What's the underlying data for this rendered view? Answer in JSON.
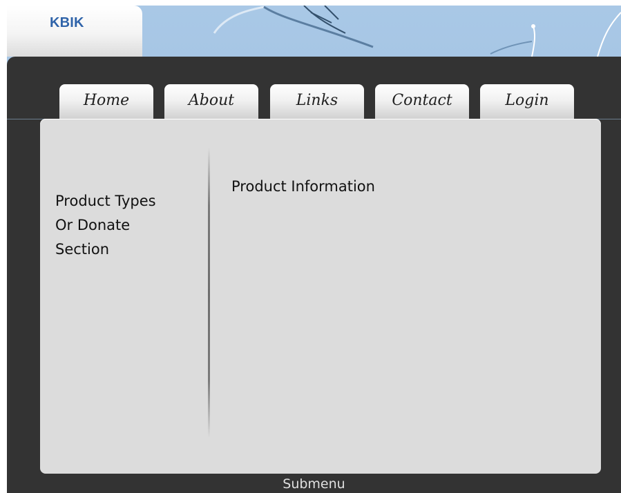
{
  "header": {
    "logo": "KBIK"
  },
  "nav": {
    "tabs": [
      {
        "label": "Home"
      },
      {
        "label": "About"
      },
      {
        "label": "Links"
      },
      {
        "label": "Contact"
      },
      {
        "label": "Login"
      }
    ]
  },
  "sidebar": {
    "text": "Product Types\nOr Donate\nSection"
  },
  "main": {
    "text": "Product Information"
  },
  "footer": {
    "submenu_label": "Submenu"
  },
  "colors": {
    "background_sky": "#9dbfe0",
    "shell": "#333333",
    "panel": "#dcdcdc",
    "logo": "#2f63a9"
  }
}
